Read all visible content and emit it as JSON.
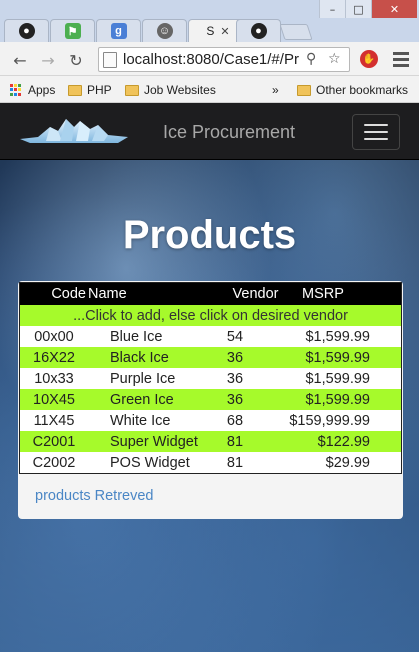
{
  "browser": {
    "tabs": [
      {
        "title": "",
        "icon": "github-icon"
      },
      {
        "title": "",
        "icon": "maps-icon"
      },
      {
        "title": "",
        "icon": "google-plus-icon"
      },
      {
        "title": "",
        "icon": "avatar-icon"
      },
      {
        "title": "S",
        "icon": "page-icon",
        "active": true
      },
      {
        "title": "",
        "icon": "github-icon"
      }
    ],
    "url": "localhost:8080/Case1/#/Pr",
    "bookmarks": {
      "apps_label": "Apps",
      "items": [
        "PHP",
        "Job Websites"
      ],
      "overflow_label": "»",
      "other_label": "Other bookmarks"
    }
  },
  "navbar": {
    "brand": "Ice Procurement"
  },
  "page": {
    "heading": "Products",
    "table": {
      "headers": {
        "code": "Code",
        "name": "Name",
        "vendor": "Vendor",
        "msrp": "MSRP"
      },
      "instruction": "...Click to add, else click on desired vendor",
      "rows": [
        {
          "code": "00x00",
          "name": "Blue Ice",
          "vendor": "54",
          "msrp": "$1,599.99"
        },
        {
          "code": "16X22",
          "name": "Black Ice",
          "vendor": "36",
          "msrp": "$1,599.99"
        },
        {
          "code": "10x33",
          "name": "Purple Ice",
          "vendor": "36",
          "msrp": "$1,599.99"
        },
        {
          "code": "10X45",
          "name": "Green Ice",
          "vendor": "36",
          "msrp": "$1,599.99"
        },
        {
          "code": "11X45",
          "name": "White Ice",
          "vendor": "68",
          "msrp": "$159,999.99"
        },
        {
          "code": "C2001",
          "name": "Super Widget",
          "vendor": "81",
          "msrp": "$122.99"
        },
        {
          "code": "C2002",
          "name": "POS Widget",
          "vendor": "81",
          "msrp": "$29.99"
        }
      ]
    },
    "status": "products Retreved"
  },
  "colors": {
    "row_highlight": "#a6fa2b",
    "navbar_bg": "#1d1d1f",
    "status_link": "#4a86c5"
  }
}
